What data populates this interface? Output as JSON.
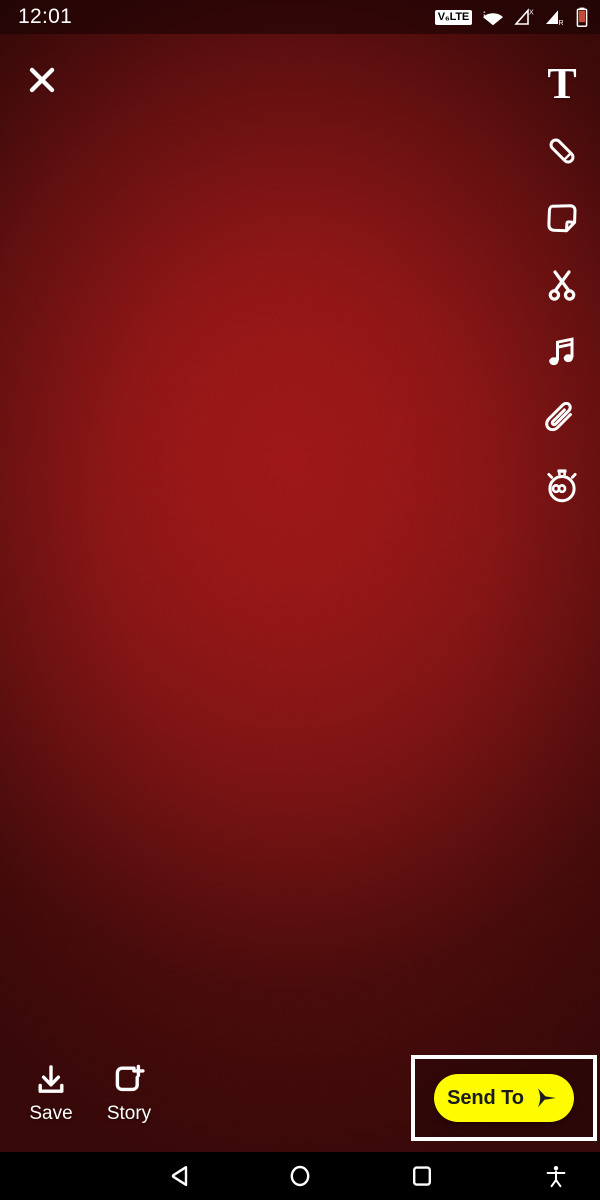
{
  "status_bar": {
    "time": "12:01",
    "icons": [
      {
        "name": "volte-indicator",
        "label": "V₆LTE"
      },
      {
        "name": "wifi-icon",
        "label": "wifi"
      },
      {
        "name": "signal-no-sim-icon",
        "label": "X"
      },
      {
        "name": "signal-roaming-icon",
        "label": "R"
      },
      {
        "name": "battery-icon",
        "label": "battery"
      }
    ]
  },
  "editor": {
    "close_label": "Close",
    "tools": [
      {
        "name": "text-tool",
        "icon": "text-t-icon",
        "label": "Text"
      },
      {
        "name": "draw-tool",
        "icon": "pencil-icon",
        "label": "Draw"
      },
      {
        "name": "sticker-tool",
        "icon": "sticker-icon",
        "label": "Stickers"
      },
      {
        "name": "scissors-tool",
        "icon": "scissors-icon",
        "label": "Scissors"
      },
      {
        "name": "music-tool",
        "icon": "music-note-icon",
        "label": "Music"
      },
      {
        "name": "attach-tool",
        "icon": "paperclip-icon",
        "label": "Attach Link"
      },
      {
        "name": "timer-tool",
        "icon": "stopwatch-infinity-icon",
        "label": "Timer"
      }
    ]
  },
  "bottom_bar": {
    "save": {
      "label": "Save",
      "icon": "download-icon"
    },
    "story": {
      "label": "Story",
      "icon": "add-to-story-icon"
    },
    "send_to": {
      "label": "Send To",
      "icon": "send-arrow-icon",
      "highlighted": "true"
    }
  },
  "nav_bar": {
    "back": "back-triangle-icon",
    "home": "home-circle-icon",
    "recents": "recents-square-icon",
    "accessibility": "accessibility-icon"
  },
  "colors": {
    "snap_yellow": "#FFFC00",
    "background_center": "#A01818",
    "background_edge": "#560D0D",
    "highlight_border": "#FFFFFF",
    "nav_bar": "#000000"
  }
}
